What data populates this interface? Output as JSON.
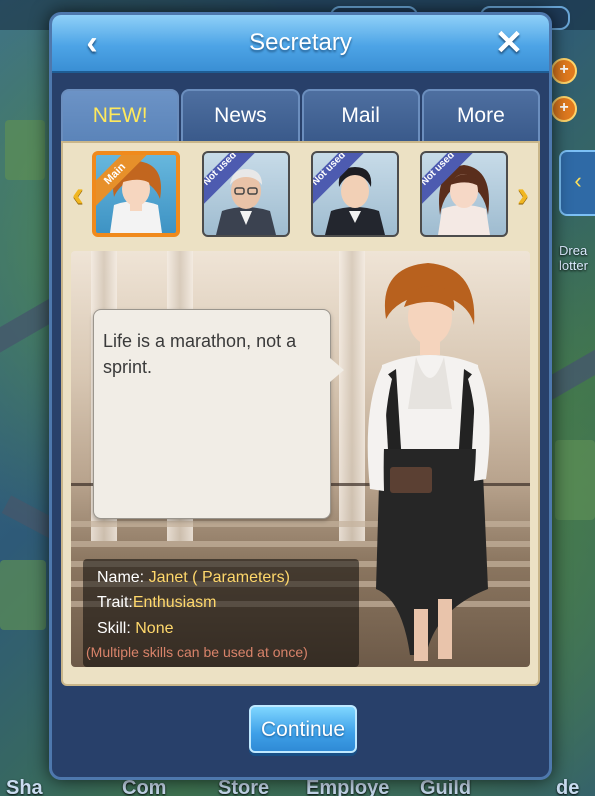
{
  "header": {
    "title": "Secretary"
  },
  "tabs": [
    {
      "label": "NEW!",
      "active": true
    },
    {
      "label": "News",
      "active": false
    },
    {
      "label": "Mail",
      "active": false
    },
    {
      "label": "More",
      "active": false
    }
  ],
  "portraits": [
    {
      "badge": "Main",
      "selected": true
    },
    {
      "badge": "Not used",
      "selected": false
    },
    {
      "badge": "Not used",
      "selected": false
    },
    {
      "badge": "Not used",
      "selected": false
    }
  ],
  "dialogue": {
    "text": "Life is a marathon, not a sprint."
  },
  "info": {
    "name_label": "Name:",
    "name_value": "Janet ( Parameters)",
    "trait_label": "Trait:",
    "trait_value": "Enthusiasm",
    "skill_label": "Skill:",
    "skill_value": "None",
    "note": "(Multiple skills can be used at once)"
  },
  "continue_label": "Continue",
  "background": {
    "side_text": "Drea lotter",
    "bottom_labels": [
      "Sha",
      "Com",
      "Store",
      "Employe",
      "Guild",
      "de"
    ]
  },
  "colors": {
    "accent": "#ffe95c",
    "highlight": "#f08a1c",
    "button": "#3ea0e8"
  }
}
